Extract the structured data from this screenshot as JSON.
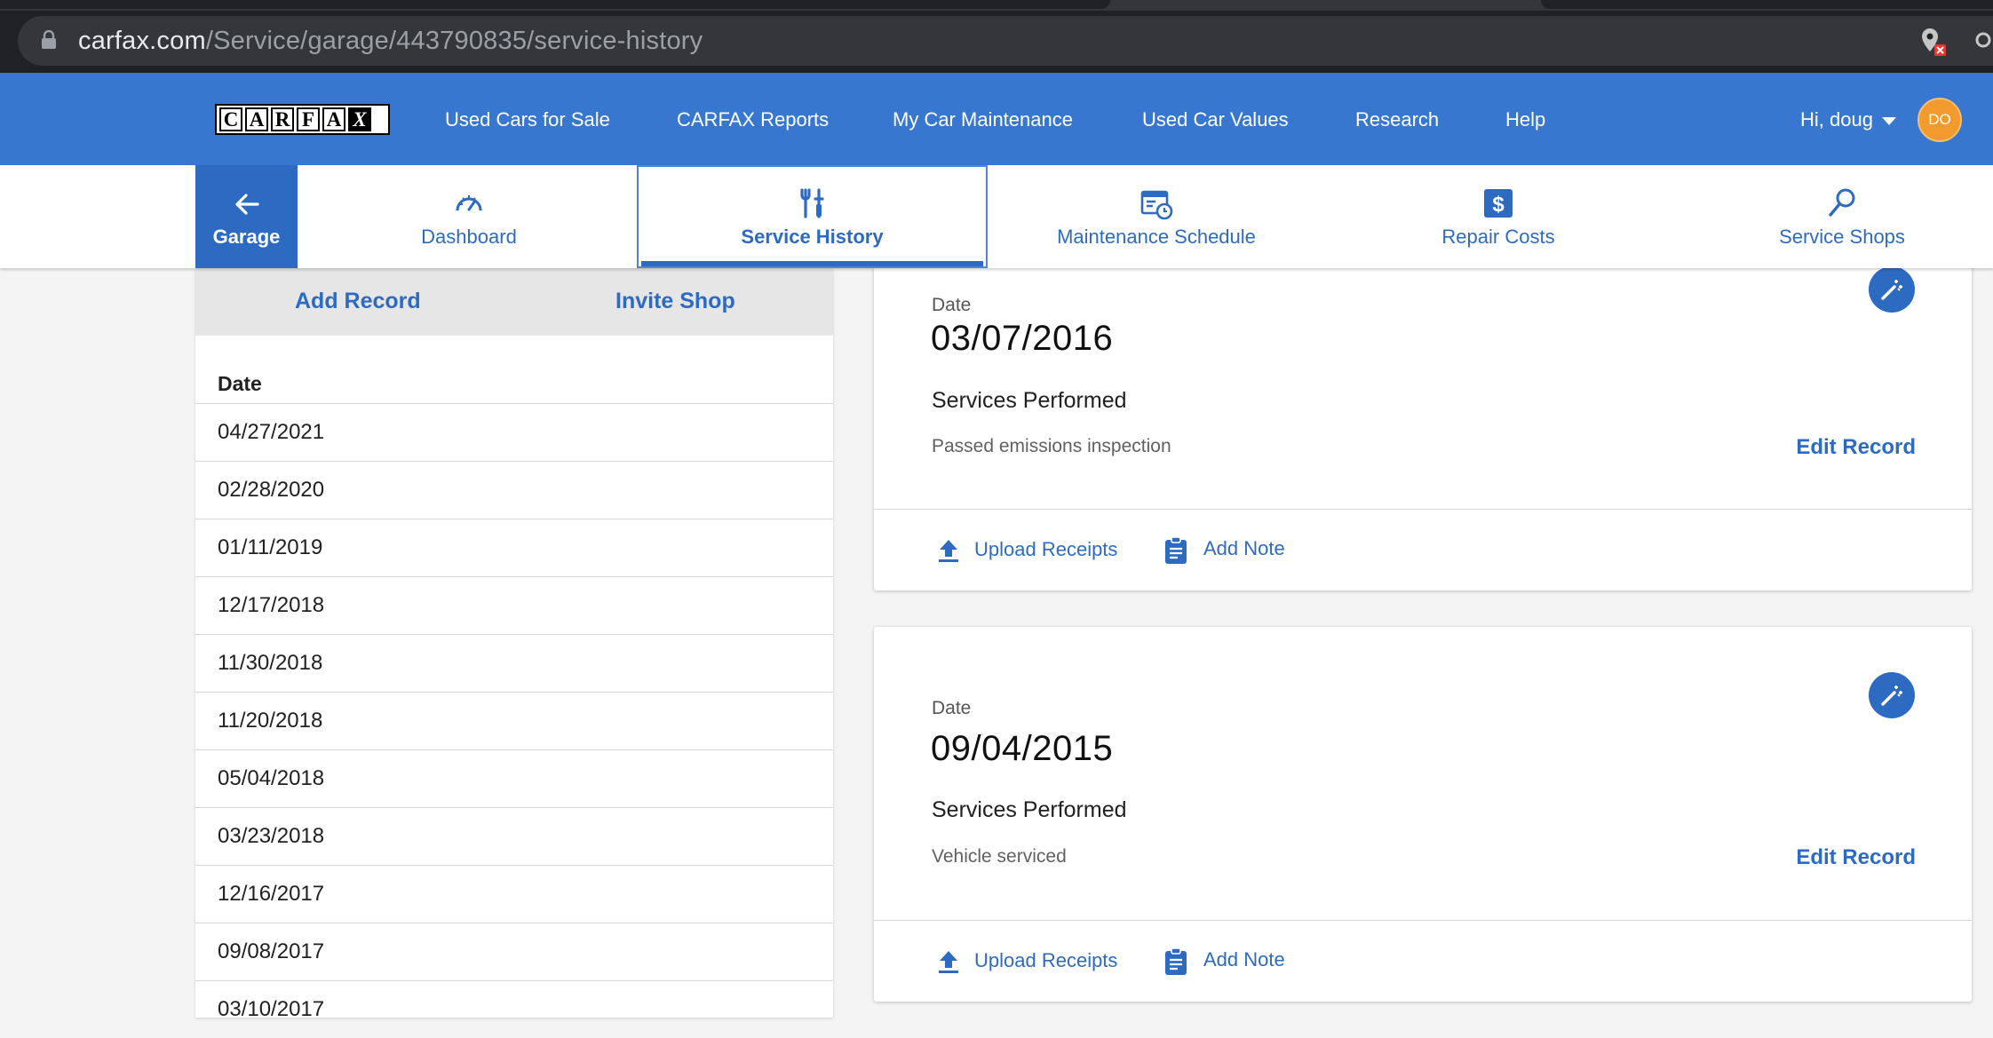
{
  "browser": {
    "url_host": "carfax.com",
    "url_path": "/Service/garage/443790835/service-history"
  },
  "header": {
    "logo": "CARFAX",
    "nav": [
      "Used Cars for Sale",
      "CARFAX Reports",
      "My Car Maintenance",
      "Used Car Values",
      "Research",
      "Help"
    ],
    "user_greeting": "Hi, doug",
    "avatar_initials": "DO"
  },
  "subnav": {
    "garage_label": "Garage",
    "tabs": [
      {
        "label": "Dashboard",
        "icon": "speedometer-icon"
      },
      {
        "label": "Service History",
        "icon": "tools-icon",
        "active": true
      },
      {
        "label": "Maintenance Schedule",
        "icon": "calendar-clock-icon"
      },
      {
        "label": "Repair Costs",
        "icon": "dollar-icon"
      },
      {
        "label": "Service Shops",
        "icon": "search-icon"
      }
    ]
  },
  "left_panel": {
    "add_record": "Add Record",
    "invite_shop": "Invite Shop",
    "date_header": "Date",
    "dates": [
      "04/27/2021",
      "02/28/2020",
      "01/11/2019",
      "12/17/2018",
      "11/30/2018",
      "11/20/2018",
      "05/04/2018",
      "03/23/2018",
      "12/16/2017",
      "09/08/2017",
      "03/10/2017"
    ]
  },
  "records": [
    {
      "date_label": "Date",
      "date": "03/07/2016",
      "services_label": "Services Performed",
      "service": "Passed emissions inspection",
      "edit": "Edit Record",
      "upload": "Upload Receipts",
      "note": "Add Note"
    },
    {
      "date_label": "Date",
      "date": "09/04/2015",
      "services_label": "Services Performed",
      "service": "Vehicle serviced",
      "edit": "Edit Record",
      "upload": "Upload Receipts",
      "note": "Add Note"
    }
  ],
  "colors": {
    "brand_blue": "#3777d0",
    "link_blue": "#2d6bc2",
    "avatar_orange": "#f29a2e"
  }
}
